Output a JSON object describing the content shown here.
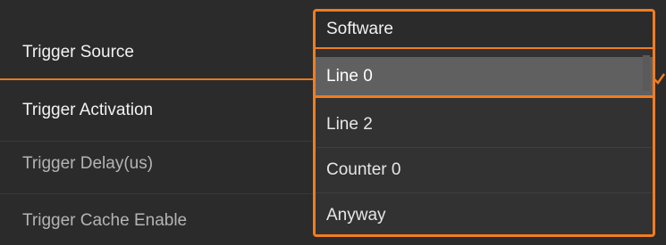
{
  "parameters": {
    "trigger_source": "Trigger Source",
    "trigger_activation": "Trigger Activation",
    "trigger_delay": "Trigger Delay(us)",
    "trigger_cache_enable": "Trigger Cache Enable"
  },
  "dropdown": {
    "selected_value": "Software",
    "options": [
      "Line 0",
      "Line 2",
      "Counter 0",
      "Anyway"
    ],
    "highlighted_option": "Line 0"
  },
  "colors": {
    "accent": "#f07d21",
    "background": "#2b2b2b",
    "highlight": "#606060"
  },
  "icons": {
    "highlight_indicator": "check-icon"
  }
}
